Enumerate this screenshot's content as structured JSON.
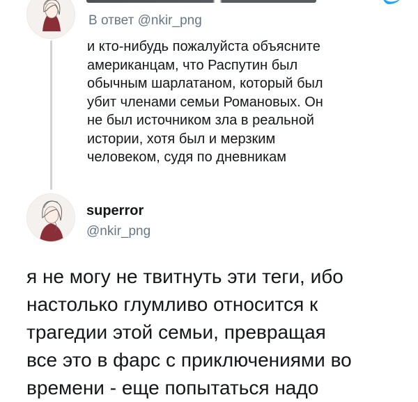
{
  "reply_tweet": {
    "reply_prefix": "В ответ",
    "reply_handle": "@nkir_png",
    "text_lines": [
      "и кто-нибудь пожалуйста объясните",
      "американцам, что Распутин был",
      "обычным шарлатаном, который был",
      "убит членами семьи Романовых. Он",
      "не был источником зла в реальной",
      "истории, хотя был и мерзким",
      "человеком, судя по дневникам"
    ]
  },
  "main_tweet": {
    "display_name": "superror",
    "handle": "@nkir_png",
    "text_lines": [
      "я не могу не твитнуть эти теги, ибо",
      "настолько глумливо относится к",
      "трагедии этой семьи, превращая",
      "все это в фарс с приключениями во",
      "времени - еще попытаться надо"
    ]
  },
  "colors": {
    "text": "#14171a",
    "secondary": "#657786",
    "thread_line": "#d0d4d8",
    "twitter_blue": "#1da1f2"
  },
  "icons": {
    "avatar": "user-avatar-illustration",
    "verified": "twitter-bird-icon"
  }
}
